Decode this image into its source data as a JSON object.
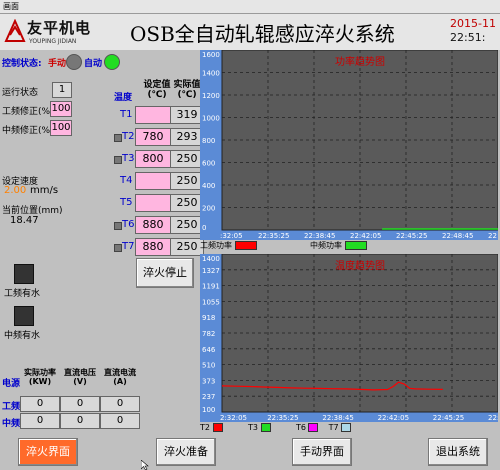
{
  "window": {
    "title": "画面"
  },
  "header": {
    "logo_cn": "友平机电",
    "logo_en": "YOUPING JIDIAN",
    "title": "OSB全自动轧辊感应淬火系统",
    "date": "2015-11",
    "time": "22:51:"
  },
  "control": {
    "label": "控制状态:",
    "manual": "手动",
    "auto": "自动",
    "manual_color": "#777777",
    "auto_color": "#22dd22"
  },
  "run_state": {
    "label": "运行状态",
    "value": "1"
  },
  "corrections": [
    {
      "label": "工频修正(%)",
      "value": "100"
    },
    {
      "label": "中频修正(%)",
      "value": "100"
    }
  ],
  "speed": {
    "label": "设定速度",
    "value": "2.00",
    "unit": "mm/s"
  },
  "position": {
    "label": "当前位置(mm)",
    "value": "18.47"
  },
  "temp_table": {
    "row_header": "温度",
    "col_set": "设定值\n(℃)",
    "col_act": "实际值\n(℃)",
    "rows": [
      {
        "name": "T1",
        "set": "",
        "act": "319"
      },
      {
        "name": "T2",
        "set": "780",
        "act": "293"
      },
      {
        "name": "T3",
        "set": "800",
        "act": "250"
      },
      {
        "name": "T4",
        "set": "",
        "act": "250"
      },
      {
        "name": "T5",
        "set": "",
        "act": "250"
      },
      {
        "name": "T6",
        "set": "880",
        "act": "250"
      },
      {
        "name": "T7",
        "set": "880",
        "act": "250"
      }
    ]
  },
  "lamps": [
    {
      "label": "工频有水"
    },
    {
      "label": "中频有水"
    }
  ],
  "buttons": {
    "quench_stop": "淬火停止",
    "quench_screen": "淬火界面",
    "quench_prepare": "淬火准备",
    "manual_screen": "手动界面",
    "exit": "退出系统"
  },
  "power_table": {
    "row_header": "电源",
    "cols": [
      "实际功率\n(KW)",
      "直流电压\n(V)",
      "直流电流\n(A)"
    ],
    "rows": [
      {
        "name": "工频",
        "values": [
          "0",
          "0",
          "0"
        ]
      },
      {
        "name": "中频",
        "values": [
          "0",
          "0",
          "0"
        ]
      }
    ]
  },
  "chart_data": [
    {
      "type": "line",
      "title": "功率趋势图",
      "yticks": [
        "1600",
        "1400",
        "1200",
        "1000",
        "800",
        "600",
        "400",
        "200",
        "0"
      ],
      "ylim": [
        0,
        1600
      ],
      "xticks": [
        ":32:05",
        "22:35:25",
        "22:38:45",
        "22:42:05",
        "22:45:25",
        "22:48:45",
        "22"
      ],
      "grid": true,
      "series": [
        {
          "name": "工频功率",
          "color": "#ff0000",
          "values": []
        },
        {
          "name": "中频功率",
          "color": "#22dd22",
          "values": []
        }
      ]
    },
    {
      "type": "line",
      "title": "温度趋势图",
      "yticks": [
        "1400",
        "1327",
        "1191",
        "1055",
        "918",
        "782",
        "646",
        "510",
        "373",
        "237",
        "100"
      ],
      "ylim": [
        100,
        1400
      ],
      "xticks": [
        "2:32:05",
        "22:35:25",
        "22:38:45",
        "22:42:05",
        "22:45:25",
        "22:48:45"
      ],
      "grid": true,
      "series": [
        {
          "name": "T2",
          "color": "#ff0000",
          "x": [
            0.0,
            0.05,
            0.1,
            0.15,
            0.2,
            0.25,
            0.3,
            0.35,
            0.4,
            0.45,
            0.5,
            0.55,
            0.6,
            0.62,
            0.64,
            0.66,
            0.68,
            0.7,
            0.75,
            0.8
          ],
          "values": [
            315,
            312,
            310,
            306,
            302,
            298,
            296,
            294,
            292,
            290,
            286,
            282,
            285,
            310,
            345,
            330,
            295,
            290,
            288,
            286
          ]
        },
        {
          "name": "T3",
          "color": "#22dd22",
          "values": []
        },
        {
          "name": "T6",
          "color": "#ff00ff",
          "values": []
        },
        {
          "name": "T7",
          "color": "#add8e6",
          "values": []
        }
      ]
    }
  ]
}
